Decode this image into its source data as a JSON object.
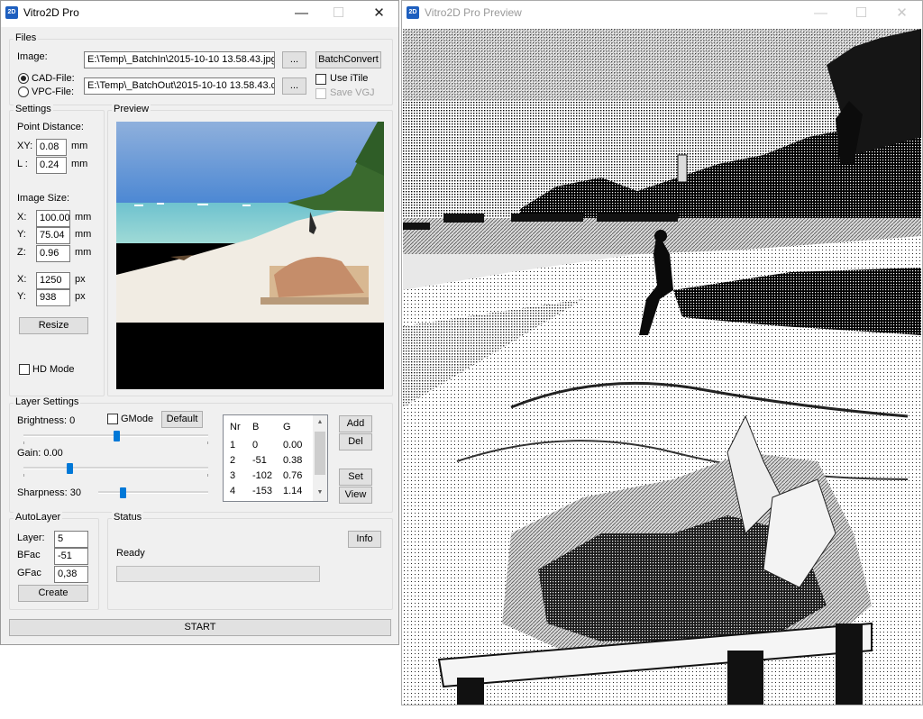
{
  "main_window": {
    "title": "Vitro2D Pro",
    "icon": "app-logo-icon",
    "controls": {
      "minimize": "—",
      "maximize": "☐",
      "close": "✕"
    }
  },
  "files": {
    "group_label": "Files",
    "image_label": "Image:",
    "image_path": "E:\\Temp\\_BatchIn\\2015-10-10 13.58.43.jpg",
    "browse_label": "...",
    "batch_convert_label": "BatchConvert",
    "cad_label": "CAD-File:",
    "vpc_label": "VPC-File:",
    "output_path": "E:\\Temp\\_BatchOut\\2015-10-10 13.58.43.c",
    "use_itile_label": "Use iTile",
    "save_vgj_label": "Save VGJ"
  },
  "settings": {
    "group_label": "Settings",
    "point_distance_label": "Point Distance:",
    "xy_label": "XY:",
    "xy_value": "0.08",
    "l_label": "L :",
    "l_value": "0.24",
    "mm": "mm",
    "px": "px",
    "image_size_label": "Image Size:",
    "x_label": "X:",
    "x_value": "100.00",
    "y_label": "Y:",
    "y_value": "75.04",
    "z_label": "Z:",
    "z_value": "0.96",
    "px_x_label": "X:",
    "px_x_value": "1250",
    "px_y_label": "Y:",
    "px_y_value": "938",
    "resize_label": "Resize",
    "hd_mode_label": "HD Mode"
  },
  "preview": {
    "group_label": "Preview"
  },
  "layer_settings": {
    "group_label": "Layer Settings",
    "brightness_label": "Brightness: 0",
    "gmode_label": "GMode",
    "default_label": "Default",
    "gain_label": "Gain: 0.00",
    "sharpness_label": "Sharpness: 30",
    "brightness_level": 0.5,
    "gain_level": 0.25,
    "sharpness_level": 0.22,
    "table_headers": [
      "Nr",
      "B",
      "G"
    ],
    "rows": [
      {
        "nr": "1",
        "b": "0",
        "g": "0.00"
      },
      {
        "nr": "2",
        "b": "-51",
        "g": "0.38"
      },
      {
        "nr": "3",
        "b": "-102",
        "g": "0.76"
      },
      {
        "nr": "4",
        "b": "-153",
        "g": "1.14"
      }
    ],
    "scroll_up": "▲",
    "scroll_down": "▼",
    "add_label": "Add",
    "del_label": "Del",
    "set_label": "Set",
    "view_label": "View"
  },
  "autolayer": {
    "group_label": "AutoLayer",
    "layer_label": "Layer:",
    "layer_value": "5",
    "bfac_label": "BFac",
    "bfac_value": "-51",
    "gfac_label": "GFac",
    "gfac_value": "0,38",
    "create_label": "Create"
  },
  "status": {
    "group_label": "Status",
    "info_label": "Info",
    "status_text": "Ready",
    "progress": 0
  },
  "start_label": "START",
  "preview_window": {
    "title": "Vitro2D Pro Preview",
    "controls": {
      "minimize": "—",
      "maximize": "☐",
      "close": "✕"
    }
  },
  "colors": {
    "accent": "#0078d7",
    "window_bg": "#f0f0f0"
  }
}
